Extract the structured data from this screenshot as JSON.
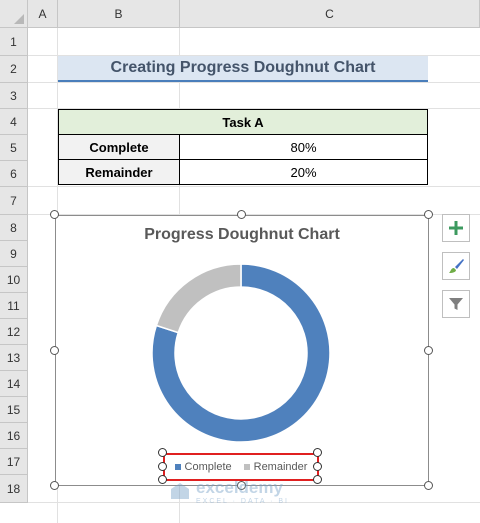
{
  "columns": [
    "A",
    "B",
    "C"
  ],
  "rows": [
    "1",
    "2",
    "3",
    "4",
    "5",
    "6",
    "7",
    "8",
    "9",
    "10",
    "11",
    "12",
    "13",
    "14",
    "15",
    "16",
    "17",
    "18"
  ],
  "sheet_title": "Creating Progress Doughnut Chart",
  "table": {
    "header": "Task A",
    "rows": [
      {
        "label": "Complete",
        "value": "80%"
      },
      {
        "label": "Remainder",
        "value": "20%"
      }
    ]
  },
  "chart_data": {
    "type": "pie",
    "donut": true,
    "title": "Progress Doughnut Chart",
    "categories": [
      "Complete",
      "Remainder"
    ],
    "values": [
      80,
      20
    ],
    "colors": [
      "#4f81bd",
      "#c0c0c0"
    ],
    "legend_position": "bottom"
  },
  "side_buttons": [
    {
      "name": "chart-elements-button",
      "icon": "plus-icon"
    },
    {
      "name": "chart-styles-button",
      "icon": "paintbrush-icon"
    },
    {
      "name": "chart-filters-button",
      "icon": "funnel-icon"
    }
  ],
  "watermark": {
    "name": "exceldemy",
    "sub": "EXCEL · DATA · BI"
  }
}
